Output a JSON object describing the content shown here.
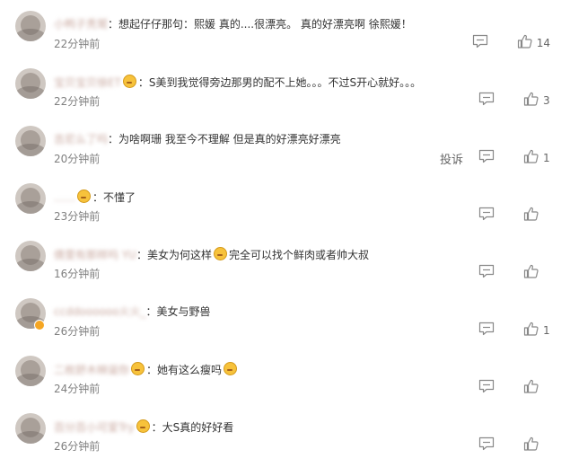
{
  "comments": [
    {
      "username": "小鸭子秃鹫",
      "text": "：想起仔仔那句：熙媛 真的....很漂亮。 真的好漂亮啊 徐熙媛！",
      "emoji_after_username": false,
      "emoji_in_text": false,
      "time": "22分钟前",
      "show_report": false,
      "likes": "14"
    },
    {
      "username": "宝贝宝贝徐ET",
      "text": "：S美到我觉得旁边那男的配不上她。。。不过S开心就好。。。",
      "emoji_after_username": true,
      "emoji_in_text": false,
      "time": "22分钟前",
      "show_report": false,
      "likes": "3"
    },
    {
      "username": "吉尼么了吗",
      "text": "：为啥啊珊 我至今不理解 但是真的好漂亮好漂亮",
      "emoji_after_username": false,
      "emoji_in_text": false,
      "time": "20分钟前",
      "show_report": true,
      "likes": "1"
    },
    {
      "username": "……",
      "text": "：不懂了",
      "emoji_after_username": true,
      "emoji_in_text": false,
      "time": "23分钟前",
      "show_report": false,
      "likes": ""
    },
    {
      "username": "倩雯有那样吗 YU",
      "text": "：美女为何这样",
      "text_after_emoji": "完全可以找个鲜肉或者帅大叔",
      "emoji_after_username": false,
      "emoji_in_text": true,
      "time": "16分钟前",
      "show_report": false,
      "likes": ""
    },
    {
      "username": "ccddoooooo火火_",
      "text": "：美女与野兽",
      "emoji_after_username": false,
      "emoji_in_text": false,
      "time": "26分钟前",
      "show_report": false,
      "likes": "1"
    },
    {
      "username": "二枚舒木映诞你",
      "text": "：她有这么瘦吗",
      "emoji_after_username": true,
      "emoji_in_text": true,
      "time": "24分钟前",
      "show_report": false,
      "likes": ""
    },
    {
      "username": "百分百小可爱Try",
      "text": "：大S真的好好看",
      "emoji_after_username": true,
      "emoji_in_text": false,
      "time": "26分钟前",
      "show_report": false,
      "likes": ""
    }
  ],
  "labels": {
    "report": "投诉"
  },
  "colors": {
    "username": "#eb7350",
    "time": "#808080",
    "text": "#333333",
    "icon": "#888888"
  },
  "icons": {
    "comment": "comment-icon",
    "like": "thumbs-up-icon"
  }
}
